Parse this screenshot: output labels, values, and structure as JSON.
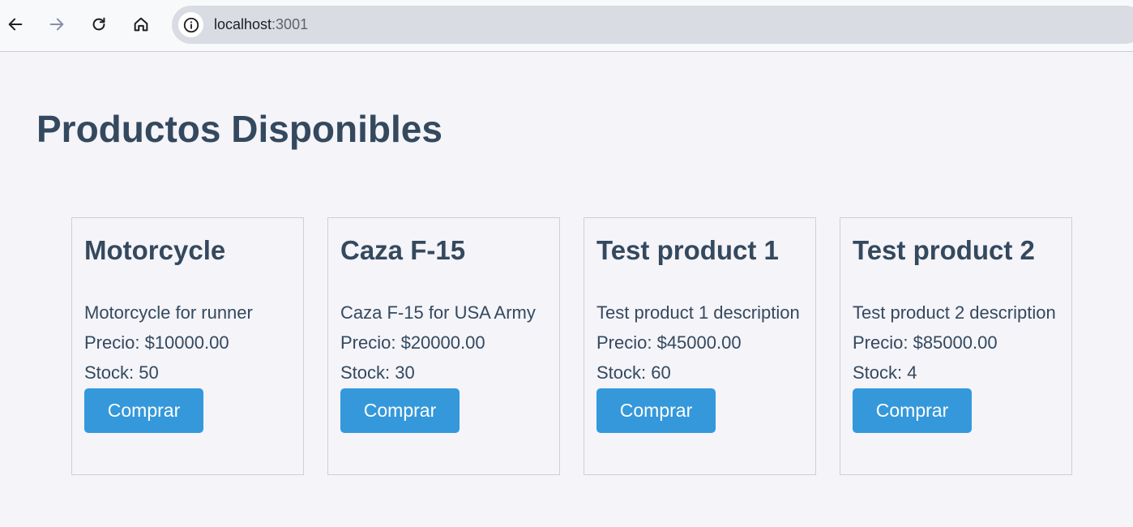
{
  "browser": {
    "url_host": "localhost",
    "url_port": ":3001"
  },
  "page": {
    "title": "Productos Disponibles"
  },
  "products": [
    {
      "name": "Motorcycle",
      "description": "Motorcycle for runner",
      "price": "Precio: $10000.00",
      "stock": "Stock: 50",
      "button": "Comprar"
    },
    {
      "name": "Caza F-15",
      "description": "Caza F-15 for USA Army",
      "price": "Precio: $20000.00",
      "stock": "Stock: 30",
      "button": "Comprar"
    },
    {
      "name": "Test product 1",
      "description": "Test product 1 description",
      "price": "Precio: $45000.00",
      "stock": "Stock: 60",
      "button": "Comprar"
    },
    {
      "name": "Test product 2",
      "description": "Test product 2 description",
      "price": "Precio: $85000.00",
      "stock": "Stock: 4",
      "button": "Comprar"
    }
  ],
  "colors": {
    "heading": "#34495e",
    "button": "#3498db",
    "background": "#f4f4f9"
  }
}
